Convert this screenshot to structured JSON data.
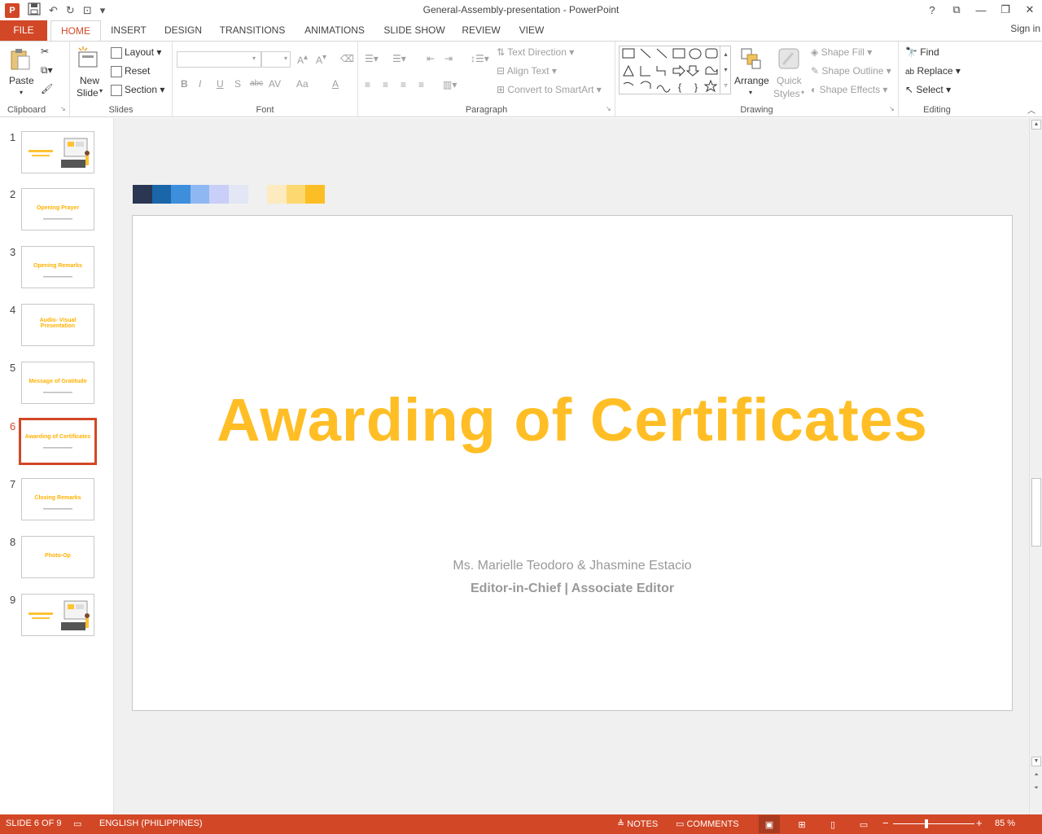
{
  "window": {
    "title": "General-Assembly-presentation - PowerPoint",
    "controls": [
      "?",
      "⧉",
      "—",
      "❐",
      "✕"
    ]
  },
  "tabs": {
    "file": "FILE",
    "items": [
      "HOME",
      "INSERT",
      "DESIGN",
      "TRANSITIONS",
      "ANIMATIONS",
      "SLIDE SHOW",
      "REVIEW",
      "VIEW"
    ],
    "active": "HOME",
    "signin": "Sign in"
  },
  "ribbon": {
    "clipboard": {
      "label": "Clipboard",
      "paste": "Paste"
    },
    "slides": {
      "label": "Slides",
      "new_slide_1": "New",
      "new_slide_2": "Slide",
      "layout": "Layout",
      "reset": "Reset",
      "section": "Section"
    },
    "font": {
      "label": "Font",
      "bold": "B",
      "italic": "I",
      "underline": "U",
      "shadow": "S",
      "strike": "abc",
      "spacing": "AV",
      "case": "Aa",
      "color": "A"
    },
    "paragraph": {
      "label": "Paragraph",
      "text_direction": "Text Direction",
      "align_text": "Align Text",
      "convert": "Convert to SmartArt"
    },
    "drawing": {
      "label": "Drawing",
      "arrange": "Arrange",
      "quick_styles_1": "Quick",
      "quick_styles_2": "Styles",
      "shape_fill": "Shape Fill",
      "shape_outline": "Shape Outline",
      "shape_effects": "Shape Effects"
    },
    "editing": {
      "label": "Editing",
      "find": "Find",
      "replace": "Replace",
      "select": "Select"
    }
  },
  "thumbnails": [
    {
      "num": "1",
      "title": "",
      "has_image": true
    },
    {
      "num": "2",
      "title": "Opening Prayer"
    },
    {
      "num": "3",
      "title": "Opening Remarks"
    },
    {
      "num": "4",
      "title": "Audio- Visual Presentation"
    },
    {
      "num": "5",
      "title": "Message of Gratitude"
    },
    {
      "num": "6",
      "title": "Awarding of Certificates",
      "active": true
    },
    {
      "num": "7",
      "title": "Closing Remarks"
    },
    {
      "num": "8",
      "title": "Photo-Op"
    },
    {
      "num": "9",
      "title": "",
      "has_image": true
    }
  ],
  "swatches": [
    "#2a3652",
    "#1a66a8",
    "#3d8fdc",
    "#8fb8f2",
    "#c9cff8",
    "#e3e6f4",
    "#f0f0f0",
    "#fdebbf",
    "#fdd870",
    "#fcbe25"
  ],
  "slide": {
    "title": "Awarding of Certificates",
    "names": "Ms. Marielle Teodoro & Jhasmine Estacio",
    "roles": "Editor-in-Chief | Associate Editor"
  },
  "status": {
    "slide_info": "SLIDE 6 OF 9",
    "language": "ENGLISH (PHILIPPINES)",
    "notes": "NOTES",
    "comments": "COMMENTS",
    "zoom": "85 %"
  }
}
